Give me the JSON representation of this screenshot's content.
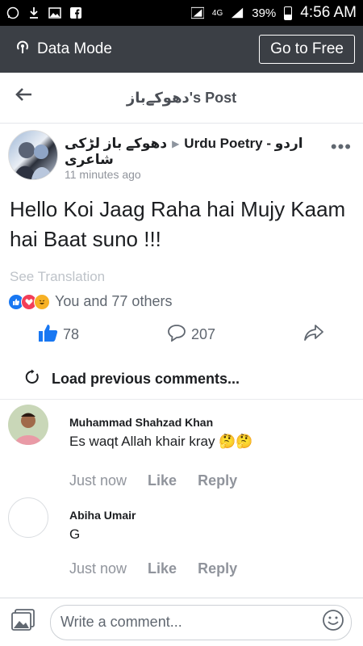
{
  "status_bar": {
    "network": "4G",
    "battery": "39%",
    "time": "4:56 AM"
  },
  "data_mode": {
    "label": "Data Mode",
    "go_free": "Go to Free"
  },
  "post_header": {
    "title": "دھوکےباز's Post"
  },
  "author": {
    "name": "دھوکے باز لڑکی",
    "group": "Urdu Poetry - اردو",
    "name_line2": "شاعری",
    "time": "11 minutes ago"
  },
  "post": {
    "text": "Hello Koi Jaag Raha hai Mujy Kaam hai Baat suno !!!",
    "see_translation": "See Translation",
    "reactions_text": "You and 77 others",
    "likes_count": "78",
    "comments_count": "207"
  },
  "load_previous": "Load previous comments...",
  "comments": [
    {
      "name": "Muhammad Shahzad Khan",
      "text": "Es waqt Allah khair kray 🤔🤔",
      "time": "Just now",
      "like": "Like",
      "reply": "Reply"
    },
    {
      "name": "Abiha Umair",
      "text": "G",
      "time": "Just now",
      "like": "Like",
      "reply": "Reply"
    }
  ],
  "composer": {
    "placeholder": "Write a comment..."
  },
  "colors": {
    "brand_blue": "#1877f2",
    "dark_bar": "#3b3f45"
  }
}
